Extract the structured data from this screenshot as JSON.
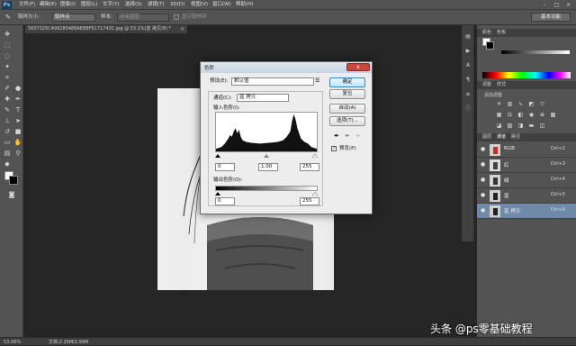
{
  "app": {
    "logo": "Ps"
  },
  "menu": [
    "文件(F)",
    "编辑(E)",
    "图像(I)",
    "图层(L)",
    "文字(Y)",
    "选择(S)",
    "滤镜(T)",
    "3D(D)",
    "视图(V)",
    "窗口(W)",
    "帮助(H)"
  ],
  "window_controls": [
    "–",
    "□",
    "×"
  ],
  "options": {
    "size_label": "取样大小:",
    "size_value": "取样点",
    "sample_label": "样本:",
    "sample_value": "所有图层",
    "show_ring": "显示取样环",
    "workspace": "基本功能"
  },
  "document": {
    "tab_title": "5607325C499280488AEB8F6171743C.jpg @ 53.1%(蓝 拷贝/8) *",
    "close": "×",
    "zoom": "53.06%",
    "doc_info": "文档:2.25M/2.99M"
  },
  "right_panel": {
    "color_tabs": [
      "颜色",
      "色板"
    ],
    "adjust_tabs": [
      "调整",
      "样式"
    ],
    "adjust_hint": "添加调整",
    "layers_tabs": [
      "图层",
      "通道",
      "路径"
    ],
    "channels": [
      {
        "name": "RGB",
        "key": "Ctrl+2",
        "eye": "👁",
        "selected": false,
        "thumb": "#bbbbbb"
      },
      {
        "name": "红",
        "key": "Ctrl+3",
        "eye": "👁",
        "selected": false,
        "thumb": "#cccccc"
      },
      {
        "name": "绿",
        "key": "Ctrl+4",
        "eye": "👁",
        "selected": false,
        "thumb": "#bcbcbc"
      },
      {
        "name": "蓝",
        "key": "Ctrl+5",
        "eye": "👁",
        "selected": false,
        "thumb": "#aaaaaa"
      },
      {
        "name": "蓝 拷贝",
        "key": "Ctrl+6",
        "eye": "👁",
        "selected": true,
        "thumb": "#999999"
      }
    ]
  },
  "dialog": {
    "title": "色阶",
    "close": "x",
    "preset_label": "预设(E):",
    "preset_value": "默认值",
    "channel_label": "通道(C):",
    "channel_value": "蓝 拷贝",
    "input_label": "输入色阶(I):",
    "input_values": [
      "0",
      "1.00",
      "255"
    ],
    "output_label": "输出色阶(O):",
    "output_values": [
      "0",
      "255"
    ],
    "buttons": {
      "ok": "确定",
      "reset": "复位",
      "auto": "自动(A)",
      "options": "选项(T)..."
    },
    "preview_label": "预览(P)",
    "preview_checked": "✓"
  },
  "watermark": "头条 @ps零基础教程"
}
